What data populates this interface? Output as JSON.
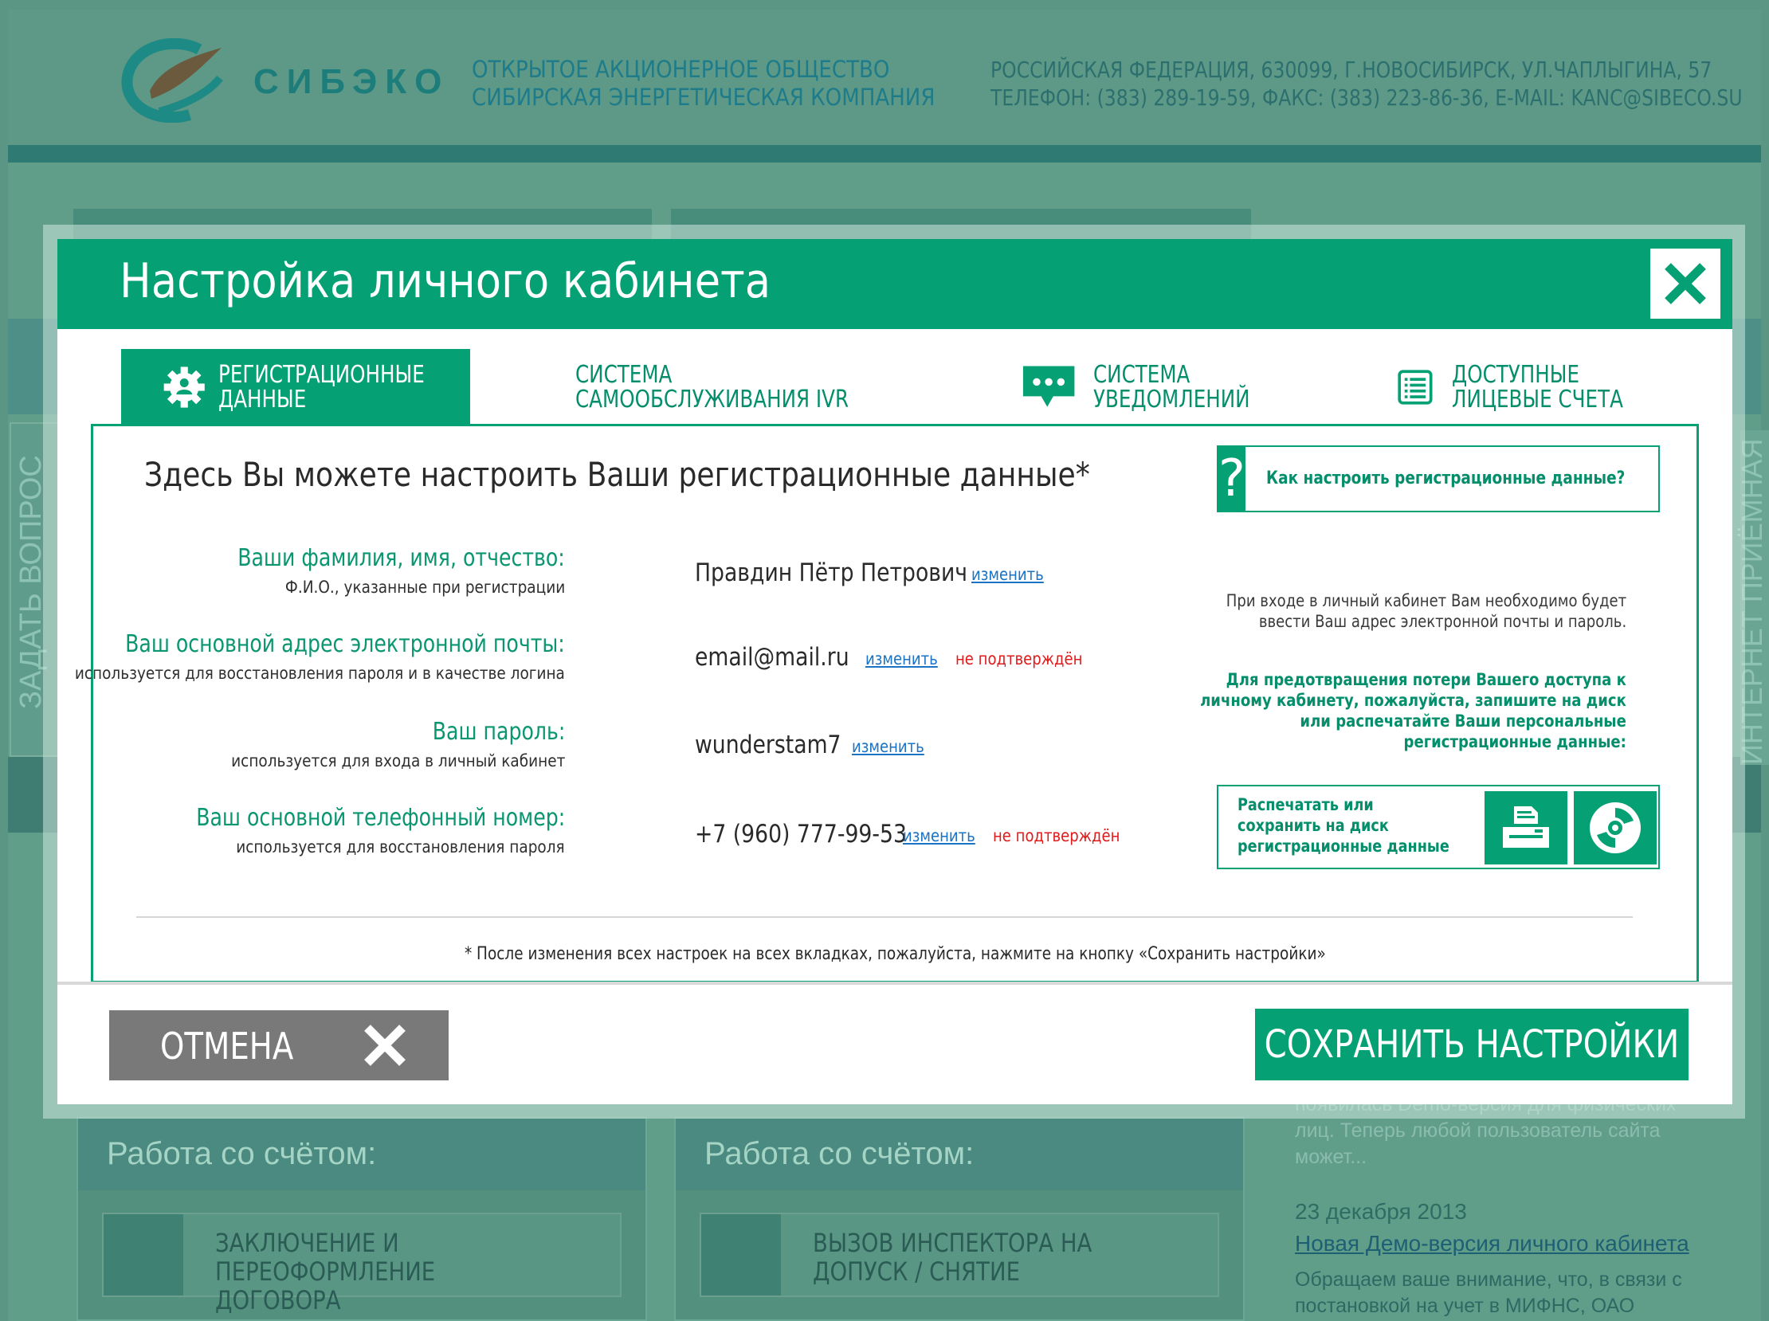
{
  "background": {
    "logo_text": "СИБЭКО",
    "company_line1": "ОТКРЫТОЕ АКЦИОНЕРНОЕ ОБЩЕСТВО",
    "company_line2": "СИБИРСКАЯ ЭНЕРГЕТИЧЕСКАЯ КОМПАНИЯ",
    "contacts_line1": "РОССИЙСКАЯ ФЕДЕРАЦИЯ, 630099, Г.НОВОСИБИРСК, УЛ.ЧАПЛЫГИНА, 57",
    "contacts_line2": "ТЕЛЕФОН: (383) 289-19-59, ФАКС: (383) 223-86-36, E-MAIL: KANC@SIBECO.SU",
    "left_side_tab": "ЗАДАТЬ ВОПРОС",
    "right_side_tab": "ИНТЕРНЕТ ПРИЁМНАЯ",
    "card1_title": "Работа со счётом:",
    "card1_item": "ЗАКЛЮЧЕНИЕ И ПЕРЕОФОРМЛЕНИЕ ДОГОВОРА",
    "card2_title": "Работа со счётом:",
    "card2_item": "ВЫЗОВ ИНСПЕКТОРА НА ДОПУСК / СНЯТИЕ",
    "news1_text": "появилась Demo-версия для физических лиц. Теперь любой пользователь сайта может...",
    "news2_date": "23 декабря 2013",
    "news2_link": "Новая Демо-версия личного кабинета",
    "news2_text": "Обращаем ваше внимание, что, в связи с постановкой на учет в МИФНС, ОАО"
  },
  "modal": {
    "title": "Настройка личного кабинета",
    "tabs": [
      {
        "label_line1": "РЕГИСТРАЦИОННЫЕ",
        "label_line2": "ДАННЫЕ",
        "icon": "gear-icon",
        "active": true
      },
      {
        "label_line1": "СИСТЕМА",
        "label_line2": "САМООБСЛУЖИВАНИЯ IVR",
        "icon": "head-icon",
        "active": false
      },
      {
        "label_line1": "СИСТЕМА",
        "label_line2": "УВЕДОМЛЕНИЙ",
        "icon": "chat-icon",
        "active": false
      },
      {
        "label_line1": "ДОСТУПНЫЕ",
        "label_line2": "ЛИЦЕВЫЕ СЧЕТА",
        "icon": "list-icon",
        "active": false
      }
    ],
    "intro": "Здесь Вы можете настроить Ваши регистрационные данные*",
    "help": {
      "icon": "?",
      "text": "Как настроить регистрационные данные?"
    },
    "fields": [
      {
        "label": "Ваши фамилия, имя, отчество:",
        "sub": "Ф.И.О., указанные при регистрации",
        "value": "Правдин Пётр Петрович",
        "edit": "изменить",
        "status": ""
      },
      {
        "label": "Ваш основной адрес электронной почты:",
        "sub": "используется для восстановления пароля и в качестве логина",
        "value": "email@mail.ru",
        "edit": "изменить",
        "status": "не подтверждён"
      },
      {
        "label": "Ваш пароль:",
        "sub": "используется для входа в личный кабинет",
        "value": "wunderstam7",
        "edit": "изменить",
        "status": ""
      },
      {
        "label": "Ваш основной телефонный номер:",
        "sub": "используется для восстановления пароля",
        "value": "+7 (960) 777-99-53",
        "edit": "изменить",
        "status": "не подтверждён"
      }
    ],
    "note_login": [
      "При входе в личный кабинет Вам необходимо будет",
      "ввести Ваш адрес электронной почты и пароль."
    ],
    "note_save": [
      "Для предотвращения потери Вашего доступа к",
      "личному кабинету, пожалуйста, запишите на диск",
      "или распечатайте Ваши персональные",
      "регистрационные данные:"
    ],
    "print_box": [
      "Распечатать или",
      "сохранить на диск",
      "регистрационные данные"
    ],
    "footnote": "* После изменения всех настроек на всех вкладках, пожалуйста, нажмите на кнопку «Сохранить настройки»",
    "cancel_label": "ОТМЕНА",
    "save_label": "СОХРАНИТЬ НАСТРОЙКИ"
  },
  "colors": {
    "accent": "#05a074",
    "link": "#1a73c4",
    "error": "#e01b1b",
    "cancel": "#797979"
  }
}
